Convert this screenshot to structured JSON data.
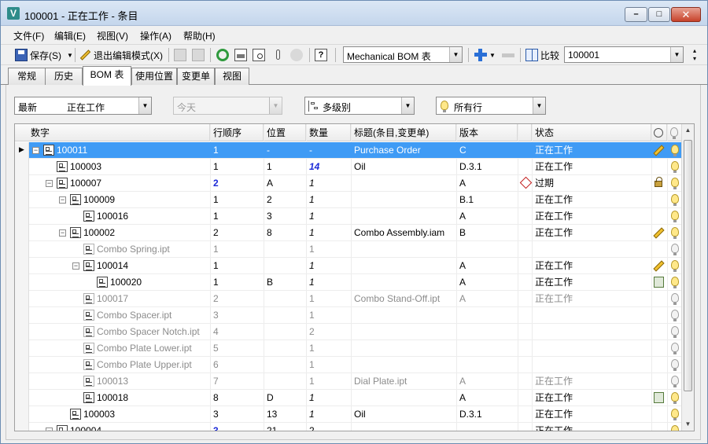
{
  "window": {
    "title": "100001 - 正在工作 - 条目"
  },
  "menu": [
    "文件(F)",
    "编辑(E)",
    "视图(V)",
    "操作(A)",
    "帮助(H)"
  ],
  "toolbar": {
    "save_label": "保存(S)",
    "exit_edit_label": "退出编辑模式(X)",
    "bom_view": "Mechanical BOM 表",
    "compare_label": "比较",
    "compare_value": "100001"
  },
  "tabs": [
    "常规",
    "历史",
    "BOM 表",
    "使用位置",
    "变更单",
    "视图"
  ],
  "active_tab": 2,
  "filters": {
    "revision_prefix": "最新",
    "revision_value": "正在工作",
    "date_value": "今天",
    "levels": "多级别",
    "rows": "所有行"
  },
  "columns": [
    "数字",
    "行顺序",
    "位置",
    "数量",
    "标题(条目,变更单)",
    "版本",
    "状态"
  ],
  "rows": [
    {
      "num": "100011",
      "order": "1",
      "pos": "-",
      "qty": "-",
      "title": "Purchase Order",
      "ver": "C",
      "state": "正在工作",
      "level": 0,
      "toggle": "−",
      "item": true,
      "sel": true,
      "flag": "pencil",
      "bulb": "on"
    },
    {
      "num": "100003",
      "order": "1",
      "pos": "1",
      "qty": "14",
      "title": "Oil",
      "ver": "D.3.1",
      "state": "正在工作",
      "level": 1,
      "toggle": "",
      "item": true,
      "qtyStyle": "blue-b",
      "flag": "",
      "bulb": "on"
    },
    {
      "num": "100007",
      "order": "2",
      "pos": "A",
      "qty": "1",
      "title": "",
      "ver": "A",
      "state": "过期",
      "level": 1,
      "toggle": "−",
      "item": true,
      "orderStyle": "blue",
      "qtyStyle": "ital",
      "expired": true,
      "flag": "lock",
      "bulb": "on"
    },
    {
      "num": "100009",
      "order": "1",
      "pos": "2",
      "qty": "1",
      "title": "",
      "ver": "B.1",
      "state": "正在工作",
      "level": 2,
      "toggle": "−",
      "item": true,
      "qtyStyle": "ital",
      "flag": "",
      "bulb": "on"
    },
    {
      "num": "100016",
      "order": "1",
      "pos": "3",
      "qty": "1",
      "title": "",
      "ver": "A",
      "state": "正在工作",
      "level": 3,
      "toggle": "",
      "item": true,
      "qtyStyle": "ital",
      "flag": "",
      "bulb": "on"
    },
    {
      "num": "100002",
      "order": "2",
      "pos": "8",
      "qty": "1",
      "title": "Combo Assembly.iam",
      "ver": "B",
      "state": "正在工作",
      "level": 2,
      "toggle": "−",
      "item": true,
      "qtyStyle": "ital",
      "flag": "pencil",
      "bulb": "on"
    },
    {
      "num": "Combo Spring.ipt",
      "order": "1",
      "pos": "",
      "qty": "1",
      "title": "",
      "ver": "",
      "state": "",
      "level": 3,
      "toggle": "",
      "item": false,
      "dim": true,
      "flag": "",
      "bulb": "off"
    },
    {
      "num": "100014",
      "order": "1",
      "pos": "",
      "qty": "1",
      "title": "",
      "ver": "A",
      "state": "正在工作",
      "level": 3,
      "toggle": "−",
      "item": true,
      "qtyStyle": "ital",
      "flag": "pencil",
      "bulb": "on"
    },
    {
      "num": "100020",
      "order": "1",
      "pos": "B",
      "qty": "1",
      "title": "",
      "ver": "A",
      "state": "正在工作",
      "level": 4,
      "toggle": "",
      "item": true,
      "qtyStyle": "ital",
      "flag": "doc",
      "bulb": "on"
    },
    {
      "num": "100017",
      "order": "2",
      "pos": "",
      "qty": "1",
      "title": "Combo Stand-Off.ipt",
      "ver": "A",
      "state": "正在工作",
      "level": 3,
      "toggle": "",
      "item": true,
      "dim": true,
      "light": true,
      "flag": "",
      "bulb": "off"
    },
    {
      "num": "Combo Spacer.ipt",
      "order": "3",
      "pos": "",
      "qty": "1",
      "title": "",
      "ver": "",
      "state": "",
      "level": 3,
      "toggle": "",
      "item": false,
      "dim": true,
      "flag": "",
      "bulb": "off"
    },
    {
      "num": "Combo Spacer Notch.ipt",
      "order": "4",
      "pos": "",
      "qty": "2",
      "title": "",
      "ver": "",
      "state": "",
      "level": 3,
      "toggle": "",
      "item": false,
      "dim": true,
      "flag": "",
      "bulb": "off"
    },
    {
      "num": "Combo Plate Lower.ipt",
      "order": "5",
      "pos": "",
      "qty": "1",
      "title": "",
      "ver": "",
      "state": "",
      "level": 3,
      "toggle": "",
      "item": false,
      "dim": true,
      "flag": "",
      "bulb": "off"
    },
    {
      "num": "Combo Plate Upper.ipt",
      "order": "6",
      "pos": "",
      "qty": "1",
      "title": "",
      "ver": "",
      "state": "",
      "level": 3,
      "toggle": "",
      "item": false,
      "dim": true,
      "flag": "",
      "bulb": "off"
    },
    {
      "num": "100013",
      "order": "7",
      "pos": "",
      "qty": "1",
      "title": "Dial Plate.ipt",
      "ver": "A",
      "state": "正在工作",
      "level": 3,
      "toggle": "",
      "item": true,
      "dim": true,
      "light": true,
      "flag": "",
      "bulb": "off"
    },
    {
      "num": "100018",
      "order": "8",
      "pos": "D",
      "qty": "1",
      "title": "",
      "ver": "A",
      "state": "正在工作",
      "level": 3,
      "toggle": "",
      "item": true,
      "qtyStyle": "ital",
      "flag": "doc",
      "bulb": "on"
    },
    {
      "num": "100003",
      "order": "3",
      "pos": "13",
      "qty": "1",
      "title": "Oil",
      "ver": "D.3.1",
      "state": "正在工作",
      "level": 2,
      "toggle": "",
      "item": true,
      "qtyStyle": "ital",
      "flag": "",
      "bulb": "on"
    },
    {
      "num": "100004",
      "order": "3",
      "pos": "21",
      "qty": "2",
      "title": "",
      "ver": "",
      "state": "正在工作",
      "level": 1,
      "toggle": "−",
      "item": true,
      "orderStyle": "blue",
      "flag": "",
      "bulb": "on"
    }
  ]
}
